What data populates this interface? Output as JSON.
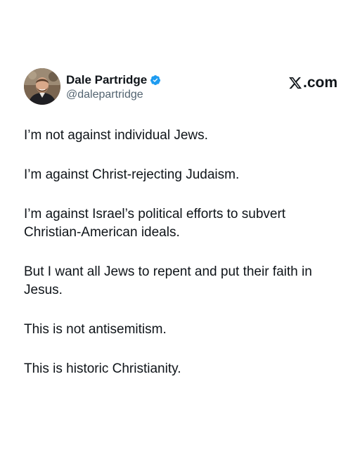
{
  "post": {
    "author_name": "Dale Partridge",
    "author_handle": "@dalepartridge",
    "brand": ".com",
    "paragraphs": [
      "I’m not against individual Jews.",
      "I’m against Christ-rejecting Judaism.",
      "I’m against Israel’s political efforts to subvert Christian-American ideals.",
      "But I want all Jews to repent and put their faith in Jesus.",
      "This is not antisemitism.",
      "This is historic Christianity."
    ]
  },
  "colors": {
    "text": "#0f1419",
    "handle": "#536471",
    "verified": "#1d9bf0",
    "background": "#ffffff"
  },
  "icons": {
    "verified": "verified-badge-icon",
    "brand": "x-logo-icon"
  }
}
